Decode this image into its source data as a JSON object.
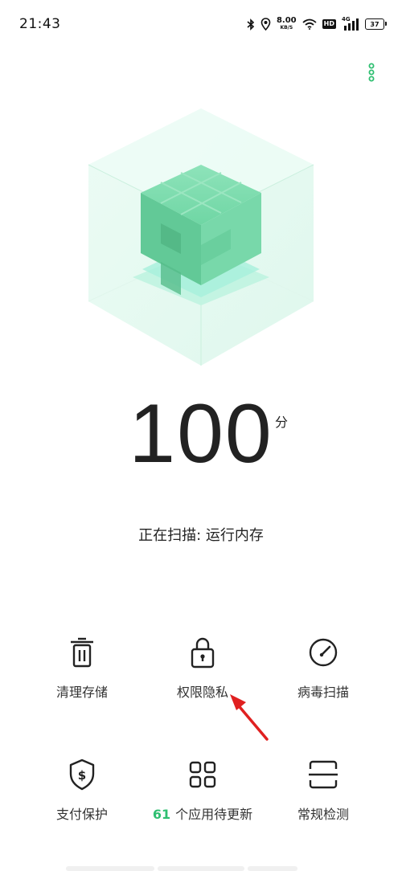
{
  "status_bar": {
    "time": "21:43",
    "speed_value": "8.00",
    "speed_unit": "KB/S",
    "hd_label": "HD",
    "network_label": "4G",
    "battery_level": "37"
  },
  "score": {
    "value": "100",
    "unit": "分"
  },
  "scan_status": "正在扫描: 运行内存",
  "features": [
    {
      "label": "清理存储",
      "icon": "trash-icon"
    },
    {
      "label": "权限隐私",
      "icon": "lock-icon"
    },
    {
      "label": "病毒扫描",
      "icon": "gauge-icon"
    },
    {
      "label": "支付保护",
      "icon": "shield-dollar-icon"
    },
    {
      "count": "61",
      "label": "个应用待更新",
      "icon": "grid-apps-icon"
    },
    {
      "label": "常规检测",
      "icon": "scan-frame-icon"
    }
  ],
  "colors": {
    "accent": "#2fbf71",
    "cube": "#6fd6a4",
    "annotation_arrow": "#e02020"
  }
}
